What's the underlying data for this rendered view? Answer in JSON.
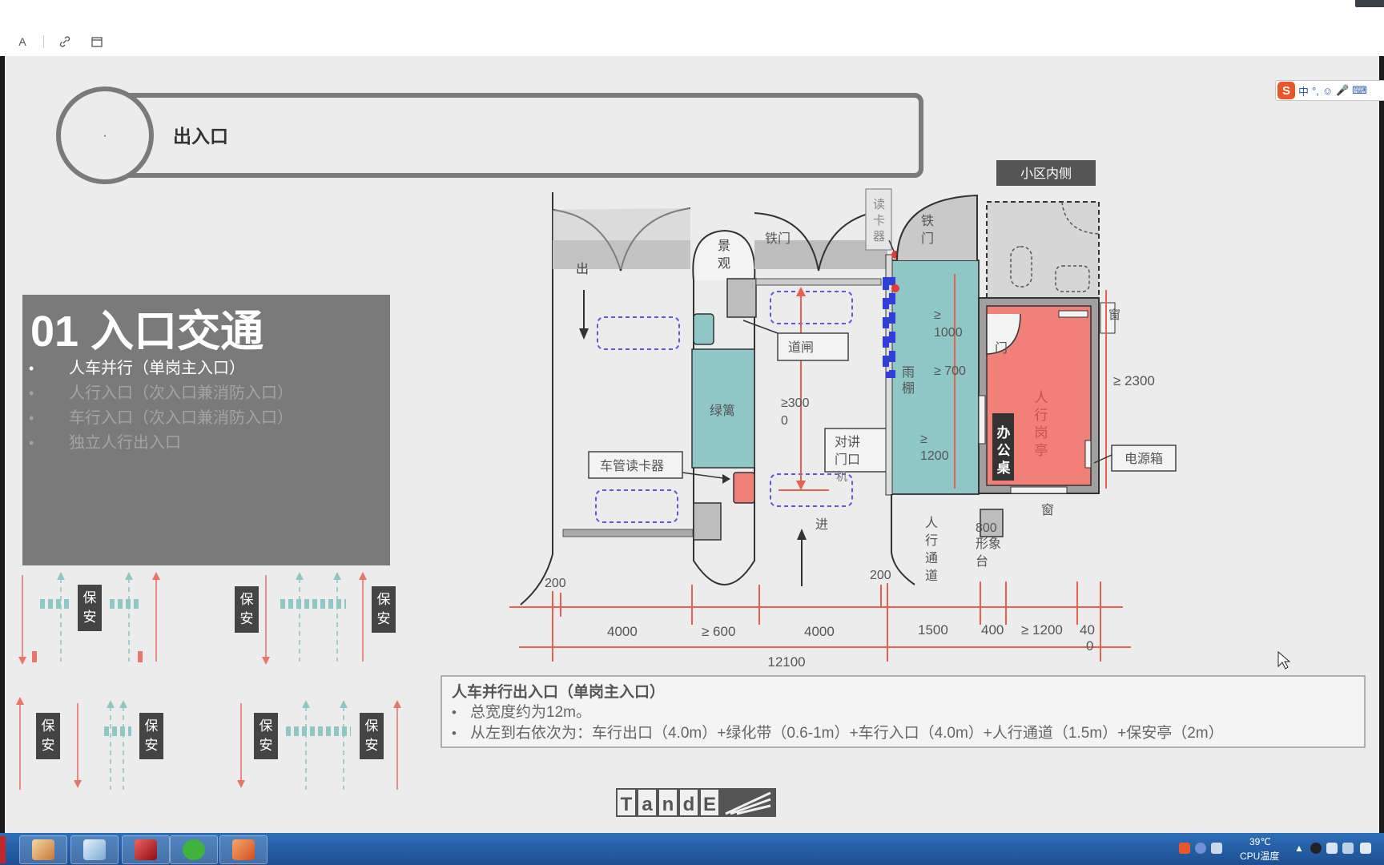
{
  "toolbar": {
    "text_tool_label": "A",
    "link_icon": "link-icon",
    "calendar_icon": "calendar-icon"
  },
  "slide": {
    "header_title": "出入口",
    "header_circle_dot": "·",
    "panel": {
      "title": "01 入口交通",
      "items": [
        {
          "bullet": "•",
          "text": "人车并行（单岗主入口）"
        },
        {
          "bullet": "•",
          "text": "人行入口（次入口兼消防入口）"
        },
        {
          "bullet": "•",
          "text": "车行入口（次入口兼消防入口）"
        },
        {
          "bullet": "•",
          "text": "独立人行出入口"
        }
      ]
    },
    "guard_label": "保安",
    "plan": {
      "district_inner": "小区内侧",
      "exit": "出",
      "enter": "进",
      "landscape": "景观",
      "iron_gate": "铁门",
      "iron_gate_2": "铁门",
      "card_reader_top": "读卡器",
      "barrier": "道闸",
      "green_strip": "绿篱",
      "vehicle_card_reader": "车管读卡器",
      "intercom": "对讲门口机",
      "canopy": "雨棚",
      "door": "门",
      "desk": "办公桌",
      "guard_booth": "人行岗亭",
      "window": "窗",
      "window_right": "窗",
      "power_box": "电源箱",
      "counter_800": "800",
      "counter_label": "形象台",
      "pedestrian_passage": "人行通道",
      "dim_ge1000": "≥ 1000",
      "dim_ge700": "≥ 700",
      "dim_ge1200_v": "≥ 1200",
      "dim_ge3000": "≥300 0",
      "dim_ge2300": "≥ 2300",
      "dims_bottom": [
        "200",
        "4000",
        "≥ 600",
        "4000",
        "200",
        "1500",
        "400",
        "≥ 1200",
        "40 0"
      ],
      "dim_total": "12100"
    },
    "caption": {
      "title": "人车并行出入口（单岗主入口）",
      "lines": [
        "总宽度约为12m。",
        "从左到右依次为：车行出口（4.0m）+绿化带（0.6-1m）+车行入口（4.0m）+人行通道（1.5m）+保安亭（2m）"
      ]
    },
    "logo_text": "TandE"
  },
  "ime": {
    "logo": "S",
    "mode": "中",
    "punct": "°,",
    "emoji_icon": "smiley-icon",
    "mic_icon": "mic-icon",
    "keyboard_icon": "keyboard-icon"
  },
  "tray": {
    "temperature": "39℃",
    "temp_label": "CPU温度"
  },
  "colors": {
    "accent_red": "#e8766a",
    "teal": "#8fc7c7",
    "booth_red": "#f08078",
    "panel_gray": "#7a7a7a",
    "dim_red": "#e8604f"
  }
}
